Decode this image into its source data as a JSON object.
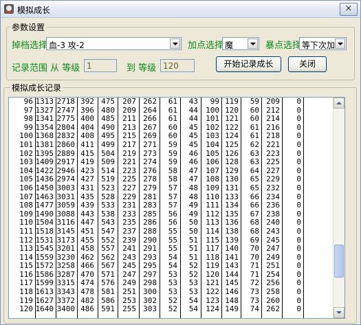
{
  "window": {
    "title": "模拟成长",
    "close_label": "×"
  },
  "params": {
    "group_label": "参数设置",
    "drop_label": "掉档选择",
    "drop_value": "血-3 攻-2",
    "addpoint_label": "加点选择",
    "addpoint_value": "魔",
    "crit_label": "暴点选择",
    "crit_value": "等下次加",
    "record_label": "记录范围 从 等级",
    "from_value": "1",
    "to_label": "到 等级",
    "to_value": "120",
    "start_button": "开始记录成长",
    "close_button": "关闭"
  },
  "log": {
    "group_label": "模拟成长记录",
    "rows": [
      [
        "96",
        "1313",
        "2718",
        "392",
        "475",
        "207",
        "262",
        "61",
        "43",
        "99",
        "119",
        "59",
        "209",
        "0"
      ],
      [
        "97",
        "1327",
        "2747",
        "396",
        "480",
        "209",
        "264",
        "61",
        "44",
        "100",
        "120",
        "60",
        "212",
        "0"
      ],
      [
        "98",
        "1341",
        "2775",
        "400",
        "485",
        "211",
        "266",
        "61",
        "44",
        "101",
        "121",
        "60",
        "214",
        "0"
      ],
      [
        "99",
        "1354",
        "2804",
        "404",
        "490",
        "213",
        "267",
        "60",
        "45",
        "102",
        "122",
        "61",
        "216",
        "0"
      ],
      [
        "100",
        "1368",
        "2832",
        "408",
        "495",
        "215",
        "269",
        "60",
        "45",
        "103",
        "124",
        "61",
        "218",
        "0"
      ],
      [
        "101",
        "1381",
        "2860",
        "411",
        "499",
        "217",
        "271",
        "59",
        "45",
        "104",
        "125",
        "62",
        "221",
        "0"
      ],
      [
        "102",
        "1395",
        "2889",
        "415",
        "504",
        "219",
        "273",
        "59",
        "46",
        "105",
        "126",
        "63",
        "223",
        "0"
      ],
      [
        "103",
        "1409",
        "2917",
        "419",
        "509",
        "221",
        "274",
        "59",
        "46",
        "106",
        "128",
        "63",
        "225",
        "0"
      ],
      [
        "104",
        "1422",
        "2946",
        "423",
        "514",
        "223",
        "276",
        "58",
        "47",
        "107",
        "129",
        "64",
        "227",
        "0"
      ],
      [
        "105",
        "1436",
        "2974",
        "427",
        "519",
        "225",
        "278",
        "58",
        "47",
        "108",
        "130",
        "65",
        "229",
        "0"
      ],
      [
        "106",
        "1450",
        "3003",
        "431",
        "523",
        "227",
        "279",
        "57",
        "48",
        "109",
        "131",
        "65",
        "232",
        "0"
      ],
      [
        "107",
        "1463",
        "3031",
        "435",
        "528",
        "229",
        "281",
        "57",
        "48",
        "110",
        "133",
        "66",
        "234",
        "0"
      ],
      [
        "108",
        "1477",
        "3059",
        "439",
        "533",
        "231",
        "283",
        "57",
        "49",
        "111",
        "134",
        "66",
        "236",
        "0"
      ],
      [
        "109",
        "1490",
        "3088",
        "443",
        "538",
        "233",
        "285",
        "56",
        "49",
        "112",
        "135",
        "67",
        "238",
        "0"
      ],
      [
        "110",
        "1504",
        "3116",
        "447",
        "543",
        "235",
        "286",
        "56",
        "50",
        "113",
        "136",
        "68",
        "240",
        "0"
      ],
      [
        "111",
        "1518",
        "3145",
        "451",
        "547",
        "237",
        "288",
        "55",
        "50",
        "114",
        "138",
        "68",
        "243",
        "0"
      ],
      [
        "112",
        "1531",
        "3173",
        "455",
        "552",
        "239",
        "290",
        "55",
        "51",
        "115",
        "139",
        "69",
        "245",
        "0"
      ],
      [
        "113",
        "1545",
        "3201",
        "458",
        "557",
        "241",
        "291",
        "55",
        "51",
        "117",
        "140",
        "70",
        "247",
        "0"
      ],
      [
        "114",
        "1559",
        "3230",
        "462",
        "562",
        "243",
        "293",
        "54",
        "51",
        "118",
        "141",
        "70",
        "249",
        "0"
      ],
      [
        "115",
        "1572",
        "3258",
        "466",
        "567",
        "245",
        "295",
        "54",
        "52",
        "119",
        "143",
        "71",
        "251",
        "0"
      ],
      [
        "116",
        "1586",
        "3287",
        "470",
        "571",
        "247",
        "297",
        "53",
        "52",
        "120",
        "144",
        "71",
        "254",
        "0"
      ],
      [
        "117",
        "1599",
        "3315",
        "474",
        "576",
        "249",
        "298",
        "53",
        "53",
        "121",
        "145",
        "72",
        "256",
        "0"
      ],
      [
        "118",
        "1613",
        "3343",
        "478",
        "581",
        "251",
        "300",
        "53",
        "53",
        "122",
        "146",
        "73",
        "258",
        "0"
      ],
      [
        "119",
        "1627",
        "3372",
        "482",
        "586",
        "253",
        "302",
        "52",
        "54",
        "123",
        "148",
        "73",
        "260",
        "0"
      ],
      [
        "120",
        "1640",
        "3400",
        "486",
        "591",
        "255",
        "303",
        "52",
        "54",
        "124",
        "149",
        "74",
        "262",
        "0"
      ]
    ]
  },
  "scroll": {
    "position_fraction": 0.82
  }
}
